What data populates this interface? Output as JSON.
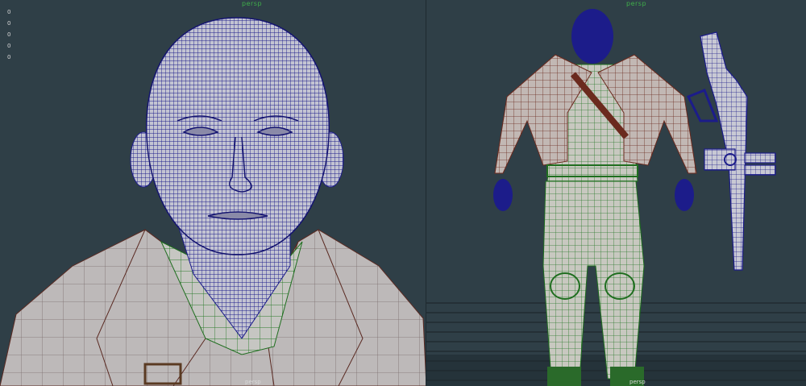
{
  "left_viewport": {
    "camera_label": "persp",
    "persp_label": "persp",
    "hud_values": [
      "0",
      "0",
      "0",
      "0",
      "0"
    ]
  },
  "right_viewport": {
    "camera_label": "persp",
    "persp_label": "persp"
  },
  "colors": {
    "background": "#2f3f47",
    "head_wire": "#1c1c8a",
    "head_fill": "#bfc0cc",
    "coat_fill": "#b7b3b3",
    "coat_wire": "#6b2a1e",
    "shirt_wire": "#1f6e1f",
    "camera_label": "#3fae4a"
  }
}
